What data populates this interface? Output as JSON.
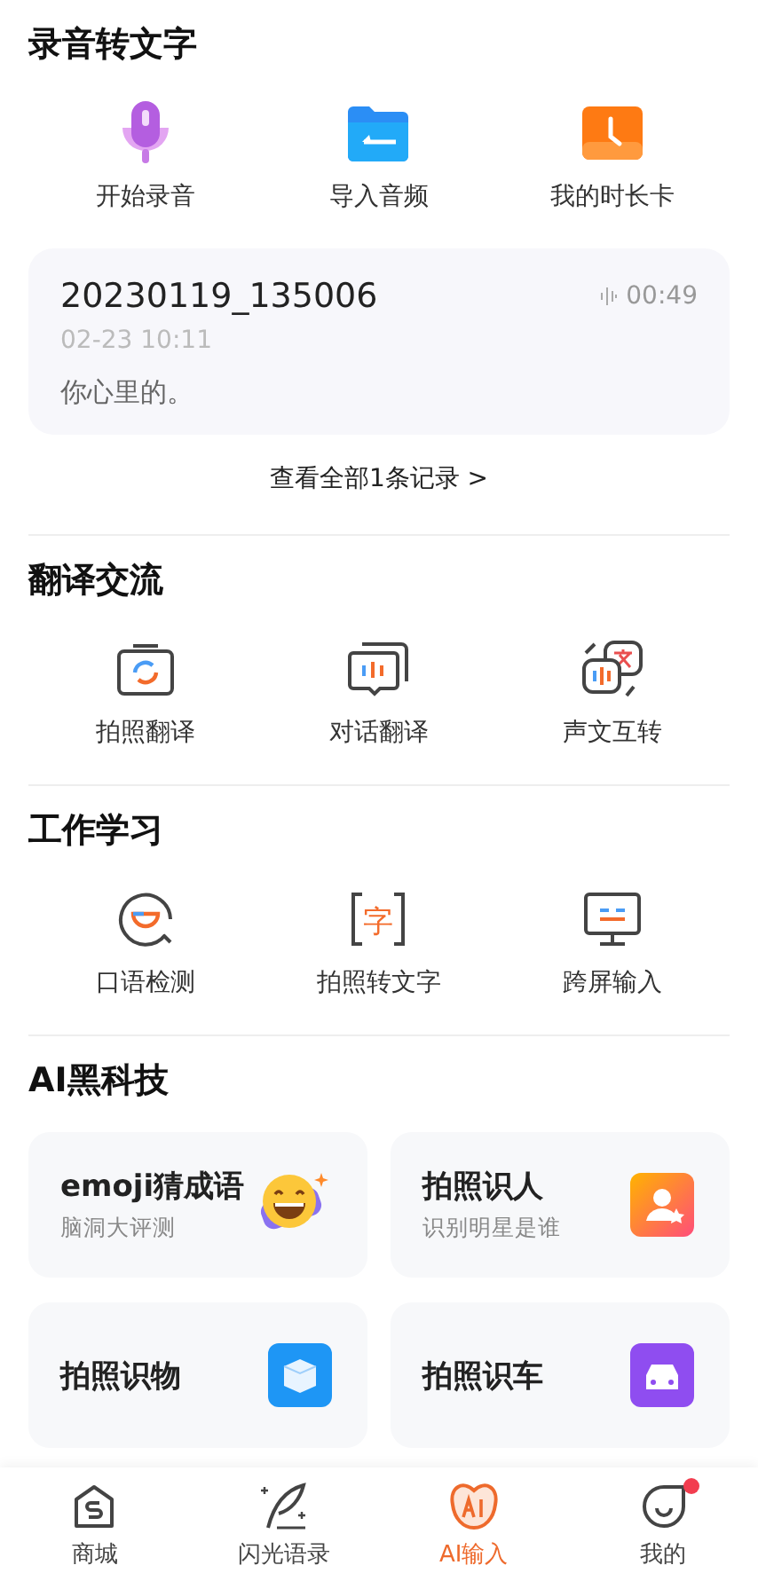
{
  "sections": [
    {
      "kind": "tools",
      "title": "录音转文字",
      "items": [
        {
          "label": "开始录音",
          "kind": "mic"
        },
        {
          "label": "导入音频",
          "kind": "folder"
        },
        {
          "label": "我的时长卡",
          "kind": "clock"
        }
      ],
      "record": {
        "name": "20230119_135006",
        "duration": "00:49",
        "date": "02-23 10:11",
        "text": "你心里的。"
      },
      "more_link": "查看全部1条记录 >"
    },
    {
      "kind": "tools",
      "title": "翻译交流",
      "items": [
        {
          "label": "拍照翻译",
          "kind": "camera"
        },
        {
          "label": "对话翻译",
          "kind": "chat"
        },
        {
          "label": "声文互转",
          "kind": "swap"
        }
      ]
    },
    {
      "kind": "tools",
      "title": "工作学习",
      "items": [
        {
          "label": "口语检测",
          "kind": "speech"
        },
        {
          "label": "拍照转文字",
          "kind": "scanchar",
          "glyph": "字"
        },
        {
          "label": "跨屏输入",
          "kind": "monitor"
        }
      ]
    },
    {
      "kind": "cards",
      "title": "AI黑科技",
      "cards": [
        {
          "title": "emoji猜成语",
          "subtitle": "脑洞大评测",
          "kind": "emoji"
        },
        {
          "title": "拍照识人",
          "subtitle": "识别明星是谁",
          "kind": "person"
        },
        {
          "title": "拍照识物",
          "kind": "cube"
        },
        {
          "title": "拍照识车",
          "kind": "car"
        }
      ]
    }
  ],
  "nav": [
    {
      "label": "商城",
      "kind": "shop",
      "selected": false,
      "dot": false
    },
    {
      "label": "闪光语录",
      "kind": "quill",
      "selected": false,
      "dot": false
    },
    {
      "label": "AI输入",
      "kind": "ai",
      "selected": true,
      "dot": false
    },
    {
      "label": "我的",
      "kind": "face",
      "selected": false,
      "dot": true
    }
  ]
}
